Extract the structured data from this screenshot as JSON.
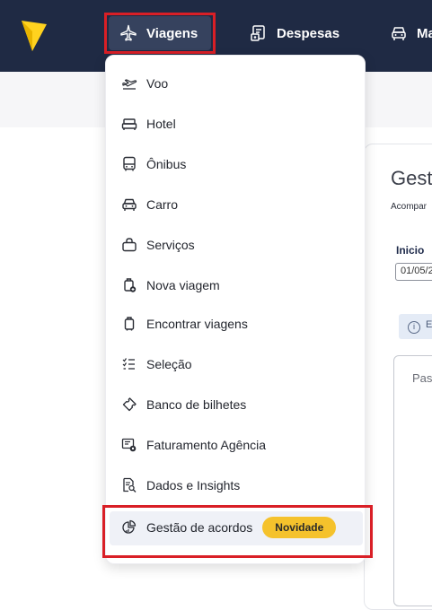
{
  "topnav": {
    "logo_icon": "logo-arrow-icon",
    "items": [
      {
        "label": "Viagens",
        "icon": "airplane-icon"
      },
      {
        "label": "Despesas",
        "icon": "receipt-icon"
      },
      {
        "label": "Ma",
        "icon": "car-icon"
      }
    ]
  },
  "background": {
    "title": "Gest",
    "subtitle": "Acompar",
    "start_label": "Inicio",
    "start_date": "01/05/2",
    "info_text": "E",
    "panel_text": "Pas"
  },
  "menu": {
    "items": [
      {
        "label": "Voo",
        "icon": "plane-takeoff-icon"
      },
      {
        "label": "Hotel",
        "icon": "bed-icon"
      },
      {
        "label": "Ônibus",
        "icon": "bus-icon"
      },
      {
        "label": "Carro",
        "icon": "car-icon"
      },
      {
        "label": "Serviços",
        "icon": "bag-icon"
      },
      {
        "label": "Nova viagem",
        "icon": "luggage-add-icon"
      },
      {
        "label": "Encontrar viagens",
        "icon": "luggage-icon"
      },
      {
        "label": "Seleção",
        "icon": "checklist-icon"
      },
      {
        "label": "Banco de bilhetes",
        "icon": "ticket-icon"
      },
      {
        "label": "Faturamento Agência",
        "icon": "invoice-gear-icon"
      },
      {
        "label": "Dados e Insights",
        "icon": "report-search-icon"
      },
      {
        "label": "Gestão de acordos",
        "icon": "pie-chart-icon",
        "badge": "Novidade"
      }
    ]
  },
  "colors": {
    "topbar": "#1f2a44",
    "active_nav": "#36425e",
    "badge": "#f5c22c",
    "highlight_frame": "#d91f26",
    "logo": "#ffd21f"
  }
}
